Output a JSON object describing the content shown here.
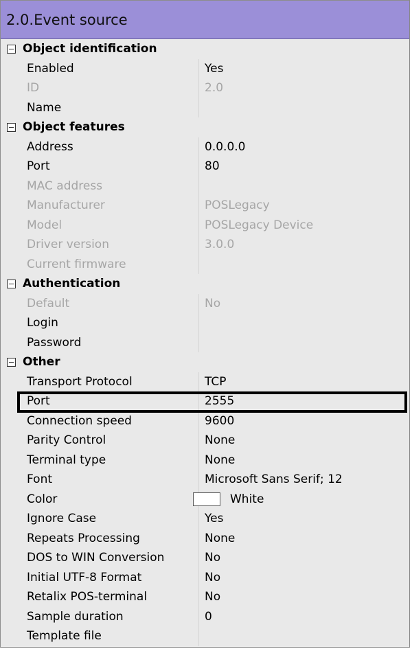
{
  "title": "2.0.Event source",
  "categories": [
    {
      "label": "Object identification",
      "rows": [
        {
          "name": "Enabled",
          "value": "Yes",
          "disabled": false
        },
        {
          "name": "ID",
          "value": "2.0",
          "disabled": true
        },
        {
          "name": "Name",
          "value": "",
          "disabled": false
        }
      ]
    },
    {
      "label": "Object features",
      "rows": [
        {
          "name": "Address",
          "value": "0.0.0.0",
          "disabled": false
        },
        {
          "name": "Port",
          "value": "80",
          "disabled": false
        },
        {
          "name": "MAC address",
          "value": "",
          "disabled": true
        },
        {
          "name": "Manufacturer",
          "value": "POSLegacy",
          "disabled": true
        },
        {
          "name": "Model",
          "value": "POSLegacy Device",
          "disabled": true
        },
        {
          "name": "Driver version",
          "value": "3.0.0",
          "disabled": true
        },
        {
          "name": "Current firmware",
          "value": "",
          "disabled": true
        }
      ]
    },
    {
      "label": "Authentication",
      "rows": [
        {
          "name": "Default",
          "value": "No",
          "disabled": true
        },
        {
          "name": "Login",
          "value": "",
          "disabled": false
        },
        {
          "name": "Password",
          "value": "",
          "disabled": false
        }
      ]
    },
    {
      "label": "Other",
      "rows": [
        {
          "name": "Transport Protocol",
          "value": "TCP",
          "disabled": false
        },
        {
          "name": "Port",
          "value": "2555",
          "disabled": false,
          "highlighted": true
        },
        {
          "name": "Connection speed",
          "value": "9600",
          "disabled": false
        },
        {
          "name": "Parity Control",
          "value": "None",
          "disabled": false
        },
        {
          "name": "Terminal type",
          "value": "None",
          "disabled": false
        },
        {
          "name": "Font",
          "value": "Microsoft Sans Serif; 12",
          "disabled": false
        },
        {
          "name": "Color",
          "value": "White",
          "disabled": false,
          "swatch": "#ffffff"
        },
        {
          "name": "Ignore Case",
          "value": "Yes",
          "disabled": false
        },
        {
          "name": "Repeats Processing",
          "value": "None",
          "disabled": false
        },
        {
          "name": "DOS to WIN Conversion",
          "value": "No",
          "disabled": false
        },
        {
          "name": "Initial UTF-8 Format",
          "value": "No",
          "disabled": false
        },
        {
          "name": "Retalix POS-terminal",
          "value": "No",
          "disabled": false
        },
        {
          "name": "Sample duration",
          "value": "0",
          "disabled": false
        },
        {
          "name": "Template file",
          "value": "",
          "disabled": false
        }
      ]
    }
  ],
  "colors": {
    "title_bar": "#9b8fd8",
    "grid_background": "#e9e9e9",
    "disabled_text": "#a6a6a6",
    "highlight_border": "#000000"
  },
  "icons": {
    "category_toggle": "collapse-minus-icon"
  }
}
